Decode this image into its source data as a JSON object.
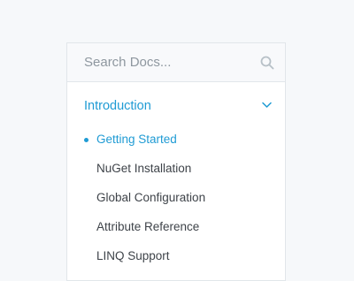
{
  "search": {
    "placeholder": "Search Docs...",
    "icon": "search-icon"
  },
  "nav": {
    "section": {
      "title": "Introduction",
      "icon": "chevron-down-icon",
      "expanded": true
    },
    "items": [
      {
        "label": "Getting Started",
        "active": true
      },
      {
        "label": "NuGet Installation",
        "active": false
      },
      {
        "label": "Global Configuration",
        "active": false
      },
      {
        "label": "Attribute Reference",
        "active": false
      },
      {
        "label": "LINQ Support",
        "active": false
      }
    ]
  },
  "colors": {
    "accent": "#1f9bd4",
    "text": "#3e4349",
    "border": "#e1e6ea",
    "background": "#f6f8fa"
  }
}
